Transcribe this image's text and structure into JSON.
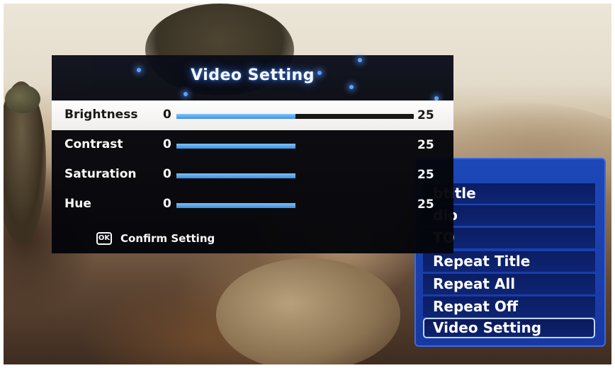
{
  "video_setting": {
    "title": "Video Setting",
    "rows": [
      {
        "label": "Brightness",
        "min": "0",
        "max": "25",
        "level": 0.5
      },
      {
        "label": "Contrast",
        "min": "0",
        "max": "25",
        "level": 0.5
      },
      {
        "label": "Saturation",
        "min": "0",
        "max": "25",
        "level": 0.5
      },
      {
        "label": "Hue",
        "min": "0",
        "max": "25",
        "level": 0.5
      }
    ],
    "confirm_icon": "OK",
    "confirm_label": "Confirm Setting"
  },
  "side_menu": {
    "items": [
      {
        "label": "btitle"
      },
      {
        "label": "dio"
      },
      {
        "label": "TO"
      },
      {
        "label": "Repeat Title"
      },
      {
        "label": "Repeat All"
      },
      {
        "label": "Repeat Off"
      },
      {
        "label": "Video Setting"
      }
    ]
  },
  "colors": {
    "panel_bg": "#05060c",
    "slider_fill": "#3d8fe0",
    "menu_bg": "#1838a2",
    "menu_item_bg": "#0e2574"
  }
}
